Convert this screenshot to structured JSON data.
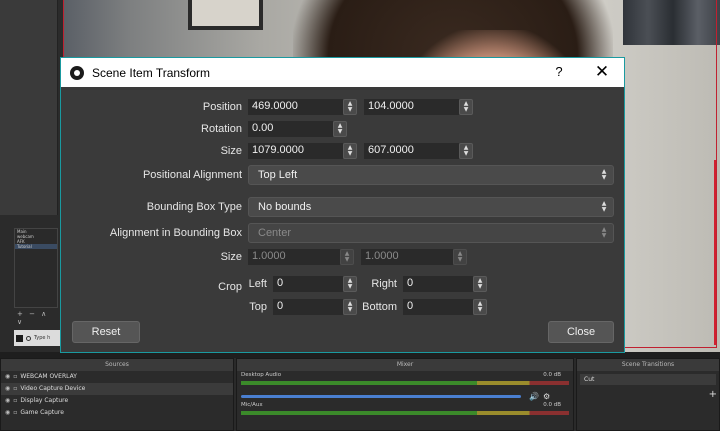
{
  "dialog": {
    "title": "Scene Item Transform",
    "help": "?",
    "close_glyph": "✕",
    "labels": {
      "position": "Position",
      "rotation": "Rotation",
      "size": "Size",
      "positional_alignment": "Positional Alignment",
      "bounding_box_type": "Bounding Box Type",
      "alignment_in_bounding_box": "Alignment in Bounding Box",
      "bounds_size": "Size",
      "crop": "Crop",
      "left": "Left",
      "right": "Right",
      "top": "Top",
      "bottom": "Bottom"
    },
    "values": {
      "position_x": "469.0000",
      "position_y": "104.0000",
      "rotation": "0.00",
      "size_w": "1079.0000",
      "size_h": "607.0000",
      "positional_alignment": "Top Left",
      "bounding_box_type": "No bounds",
      "alignment_in_bounding_box": "Center",
      "bounds_w": "1.0000",
      "bounds_h": "1.0000",
      "crop_left": "0",
      "crop_right": "0",
      "crop_top": "0",
      "crop_bottom": "0"
    },
    "buttons": {
      "reset": "Reset",
      "close": "Close"
    }
  },
  "background": {
    "scenes_list": [
      "Main",
      "webcam",
      "AFK",
      "Tutorial"
    ],
    "scenes_tools": "+ − ∧ ∨",
    "taskbar_search": "Type h"
  },
  "docks": {
    "sources": {
      "title": "Sources",
      "items": [
        "WEBCAM OVERLAY",
        "Video Capture Device",
        "Display Capture",
        "Game Capture"
      ]
    },
    "mixer": {
      "title": "Mixer",
      "channels": [
        {
          "name": "Desktop Audio",
          "level": "0.0 dB"
        },
        {
          "name": "Mic/Aux",
          "level": "0.0 dB"
        }
      ]
    },
    "transitions": {
      "title": "Scene Transitions",
      "selected": "Cut",
      "add": "+"
    }
  }
}
